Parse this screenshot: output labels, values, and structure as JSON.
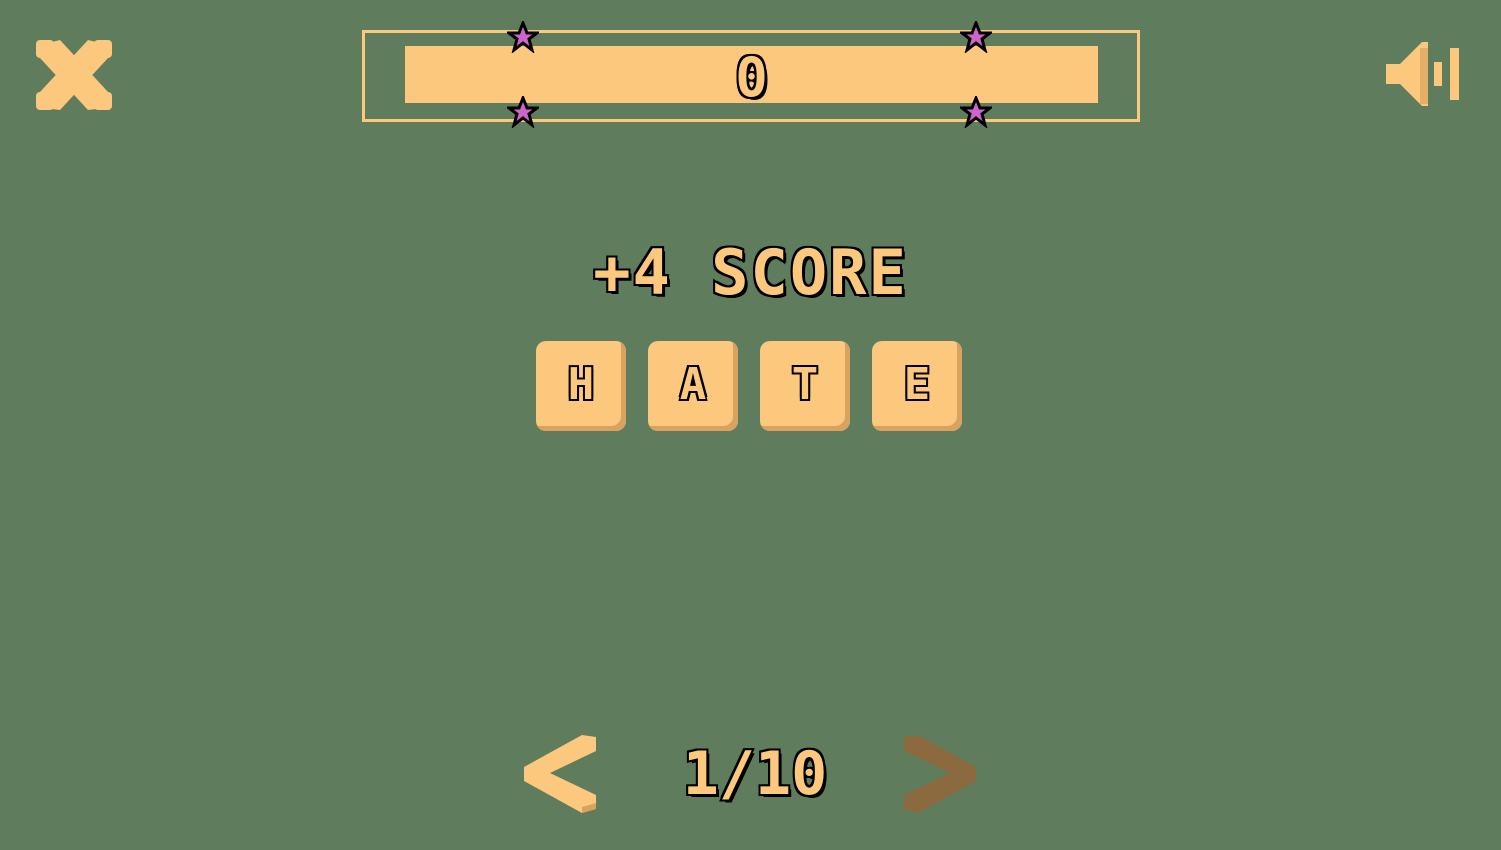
{
  "score": {
    "value": "0",
    "star_color": "#cc66cc"
  },
  "bonus": {
    "text": "+4 SCORE"
  },
  "word": {
    "letters": [
      "H",
      "A",
      "T",
      "E"
    ]
  },
  "pager": {
    "current": "1/10",
    "prev_enabled": true,
    "next_enabled": false
  },
  "colors": {
    "background": "#5f7d5d",
    "accent": "#fcc87e",
    "accent_shadow": "#d9a25f",
    "disabled": "#8a6a3e",
    "star": "#cc66cc"
  },
  "icons": {
    "close": "close-icon",
    "sound": "speaker-icon",
    "prev": "chevron-left-icon",
    "next": "chevron-right-icon",
    "star": "star-icon"
  }
}
